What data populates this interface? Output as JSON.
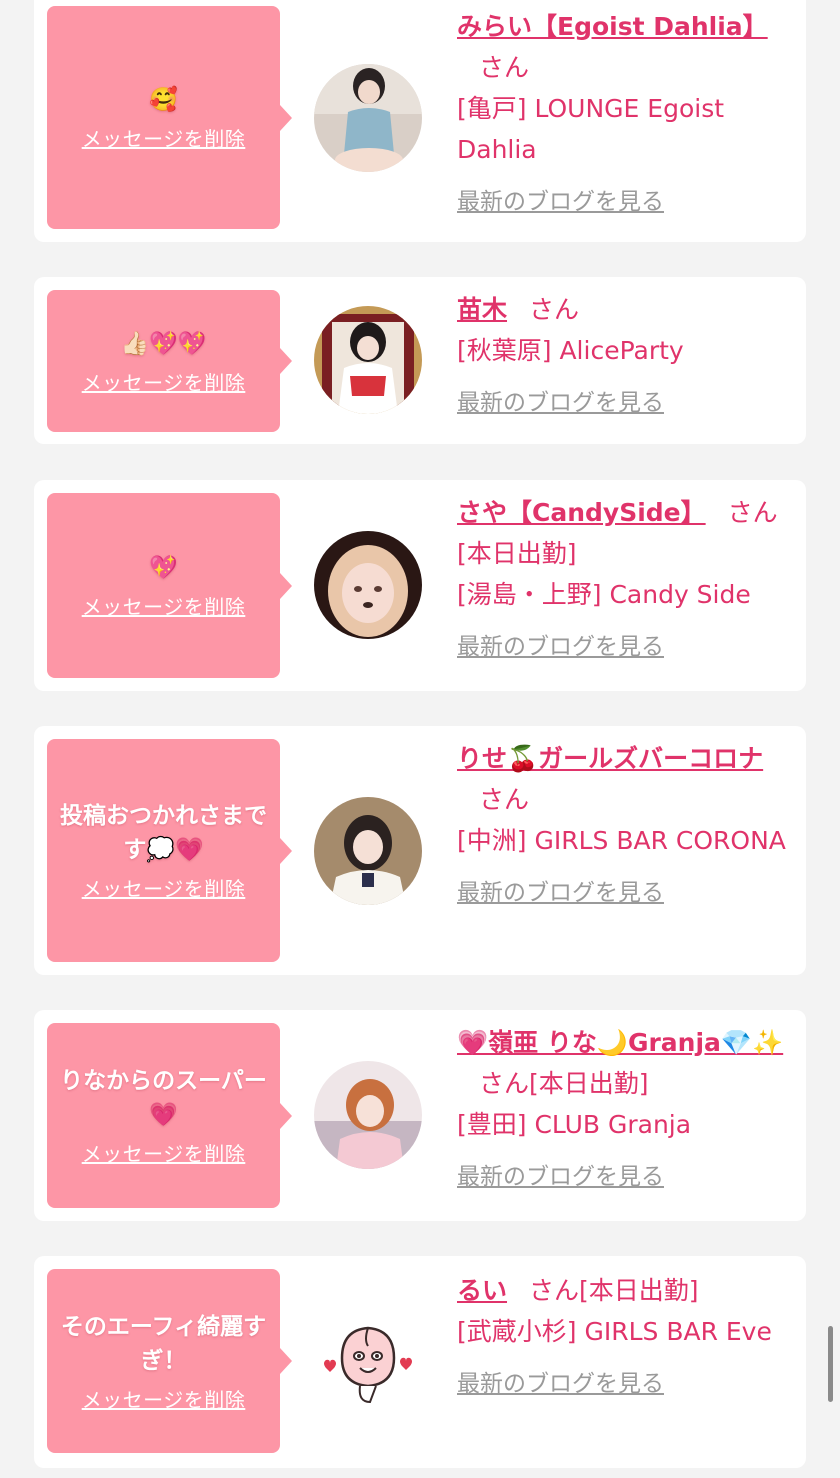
{
  "items": [
    {
      "message": "🥰",
      "delete_label": "メッセージを削除",
      "name": "みらい【Egoist Dahlia】",
      "honorific": "さん",
      "tag": "",
      "shop": "[亀戸] LOUNGE Egoist Dahlia",
      "blog_label": "最新のブログを見る"
    },
    {
      "message": "👍🏻💖💖",
      "delete_label": "メッセージを削除",
      "name": "苗木",
      "honorific": "さん",
      "tag": "",
      "shop": "[秋葉原] AliceParty",
      "blog_label": "最新のブログを見る"
    },
    {
      "message": "💖",
      "delete_label": "メッセージを削除",
      "name": "さや【CandySide】",
      "honorific": "さん",
      "tag": "[本日出勤]",
      "shop": "[湯島・上野] Candy Side",
      "blog_label": "最新のブログを見る"
    },
    {
      "message": "投稿おつかれさまです💭💗",
      "delete_label": "メッセージを削除",
      "name": "りせ🍒ガールズバーコロナ",
      "honorific": "さん",
      "tag": "",
      "shop": "[中洲] GIRLS BAR CORONA",
      "blog_label": "最新のブログを見る"
    },
    {
      "message": "りなからのスーパー💗",
      "delete_label": "メッセージを削除",
      "name": "💗嶺亜 りな🌙Granja💎✨",
      "honorific": "さん",
      "tag": "[本日出勤]",
      "shop": "[豊田] CLUB Granja",
      "blog_label": "最新のブログを見る"
    },
    {
      "message": "そのエーフィ綺麗すぎ！",
      "delete_label": "メッセージを削除",
      "name": "るい",
      "honorific": "さん",
      "tag": "[本日出勤]",
      "shop": "[武蔵小杉] GIRLS BAR Eve",
      "blog_label": "最新のブログを見る"
    }
  ],
  "colors": {
    "background": "#f3f3f3",
    "bubble": "#fd96a6",
    "accent": "#e0336a",
    "muted_link": "#9a9a9a"
  },
  "icons": [
    "avatar-photo",
    "peach-character-avatar"
  ]
}
